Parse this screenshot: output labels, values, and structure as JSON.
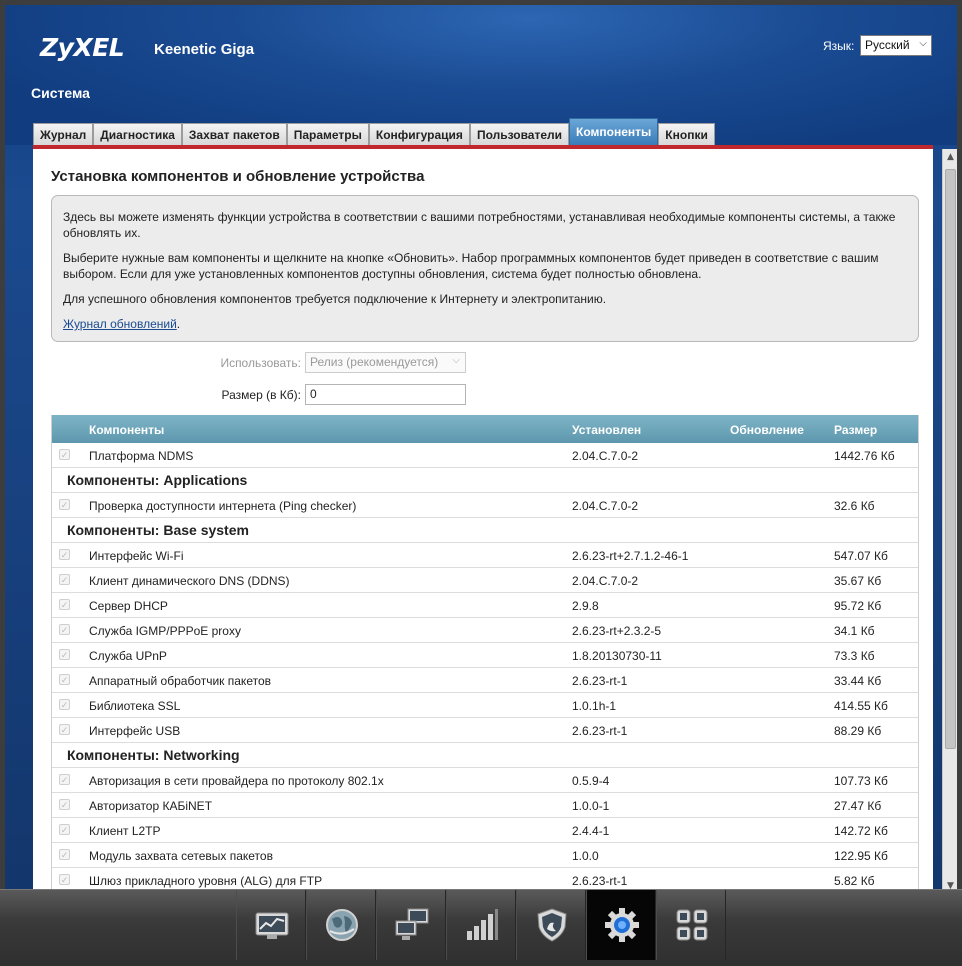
{
  "header": {
    "brand": "ZyXEL",
    "model": "Keenetic Giga",
    "language_label": "Язык:",
    "language_value": "Русский",
    "section": "Система"
  },
  "tabs": [
    {
      "label": "Журнал",
      "active": false
    },
    {
      "label": "Диагностика",
      "active": false
    },
    {
      "label": "Захват пакетов",
      "active": false
    },
    {
      "label": "Параметры",
      "active": false
    },
    {
      "label": "Конфигурация",
      "active": false
    },
    {
      "label": "Пользователи",
      "active": false
    },
    {
      "label": "Компоненты",
      "active": true
    },
    {
      "label": "Кнопки",
      "active": false
    }
  ],
  "page": {
    "heading": "Установка компонентов и обновление устройства",
    "info_paragraph_1": "Здесь вы можете изменять функции устройства в соответствии с вашими потребностями, устанавливая необходимые компоненты системы, а также обновлять их.",
    "info_paragraph_2": "Выберите нужные вам компоненты и щелкните на кнопке «Обновить». Набор программных компонентов будет приведен в соответствие с вашим выбором. Если для уже установленных компонентов доступны обновления, система будет полностью обновлена.",
    "info_paragraph_3": "Для успешного обновления компонентов требуется подключение к Интернету и электропитанию.",
    "update_log_link": "Журнал обновлений",
    "update_log_suffix": "."
  },
  "form": {
    "use_label": "Использовать:",
    "use_value": "Релиз (рекомендуется)",
    "size_label": "Размер (в Кб):",
    "size_value": "0"
  },
  "table": {
    "headers": {
      "name": "Компоненты",
      "installed": "Установлен",
      "update": "Обновление",
      "size": "Размер"
    },
    "top_row": {
      "name": "Платформа NDMS",
      "installed": "2.04.C.7.0-2",
      "update": "",
      "size": "1442.76 Кб"
    },
    "groups": [
      {
        "title": "Компоненты: Applications",
        "rows": [
          {
            "name": "Проверка доступности интернета (Ping checker)",
            "installed": "2.04.C.7.0-2",
            "update": "",
            "size": "32.6 Кб"
          }
        ]
      },
      {
        "title": "Компоненты: Base system",
        "rows": [
          {
            "name": "Интерфейс Wi-Fi",
            "installed": "2.6.23-rt+2.7.1.2-46-1",
            "update": "",
            "size": "547.07 Кб"
          },
          {
            "name": "Клиент динамического DNS (DDNS)",
            "installed": "2.04.C.7.0-2",
            "update": "",
            "size": "35.67 Кб"
          },
          {
            "name": "Сервер DHCP",
            "installed": "2.9.8",
            "update": "",
            "size": "95.72 Кб"
          },
          {
            "name": "Служба IGMP/PPPoE proxy",
            "installed": "2.6.23-rt+2.3.2-5",
            "update": "",
            "size": "34.1 Кб"
          },
          {
            "name": "Служба UPnP",
            "installed": "1.8.20130730-11",
            "update": "",
            "size": "73.3 Кб"
          },
          {
            "name": "Аппаратный обработчик пакетов",
            "installed": "2.6.23-rt-1",
            "update": "",
            "size": "33.44 Кб"
          },
          {
            "name": "Библиотека SSL",
            "installed": "1.0.1h-1",
            "update": "",
            "size": "414.55 Кб"
          },
          {
            "name": "Интерфейс USB",
            "installed": "2.6.23-rt-1",
            "update": "",
            "size": "88.29 Кб"
          }
        ]
      },
      {
        "title": "Компоненты: Networking",
        "rows": [
          {
            "name": "Авторизация в сети провайдера по протоколу 802.1x",
            "installed": "0.5.9-4",
            "update": "",
            "size": "107.73 Кб"
          },
          {
            "name": "Авторизатор КАБiNET",
            "installed": "1.0.0-1",
            "update": "",
            "size": "27.47 Кб"
          },
          {
            "name": "Клиент L2TP",
            "installed": "2.4.4-1",
            "update": "",
            "size": "142.72 Кб"
          },
          {
            "name": "Модуль захвата сетевых пакетов",
            "installed": "1.0.0",
            "update": "",
            "size": "122.95 Кб"
          },
          {
            "name": "Шлюз прикладного уровня (ALG) для FTP",
            "installed": "2.6.23-rt-1",
            "update": "",
            "size": "5.82 Кб"
          }
        ]
      }
    ]
  },
  "dock": [
    {
      "icon": "monitor-chart-icon",
      "active": false
    },
    {
      "icon": "globe-icon",
      "active": false
    },
    {
      "icon": "network-computers-icon",
      "active": false
    },
    {
      "icon": "signal-bars-icon",
      "active": false
    },
    {
      "icon": "shield-icon",
      "active": false
    },
    {
      "icon": "gear-icon",
      "active": true
    },
    {
      "icon": "apps-grid-icon",
      "active": false
    }
  ],
  "colors": {
    "background_blue": "#113c80",
    "active_tab": "#3b7cb9",
    "accent_red": "#c0282d",
    "table_header": "#5e98ae",
    "link": "#1a4b92"
  }
}
